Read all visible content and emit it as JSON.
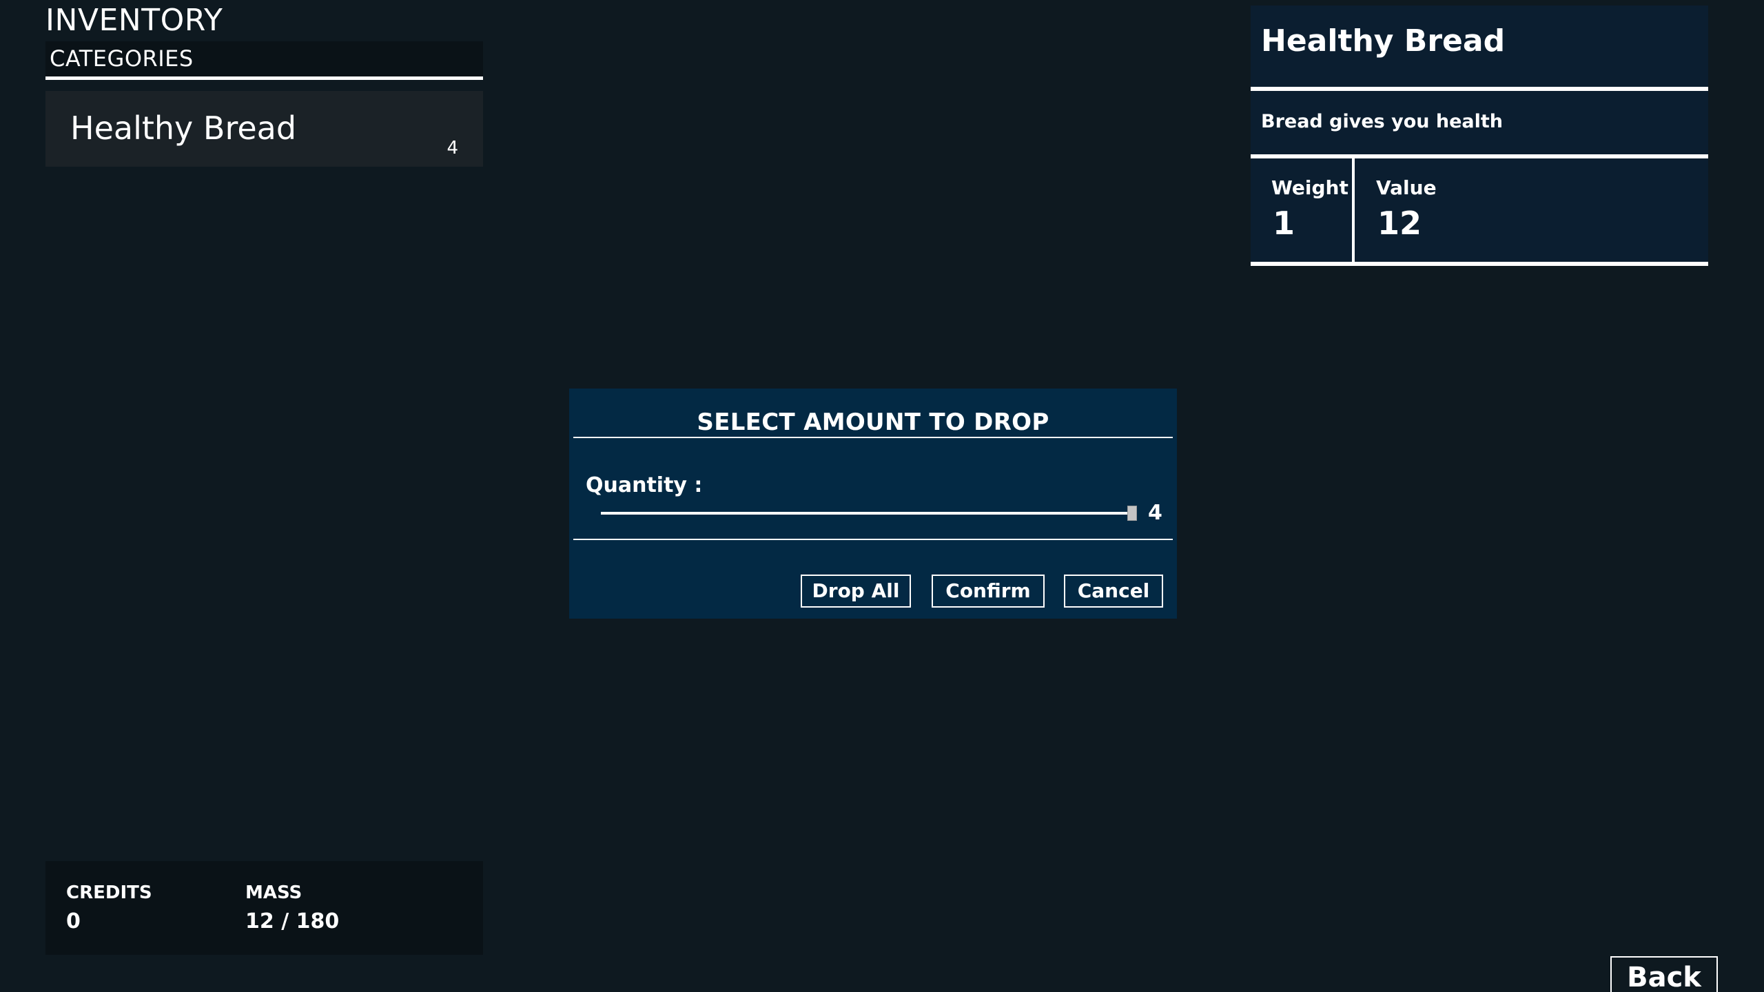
{
  "inventory": {
    "title": "INVENTORY",
    "categories_label": "CATEGORIES",
    "items": [
      {
        "name": "Healthy Bread",
        "count": "4"
      }
    ]
  },
  "stats": {
    "credits_label": "CREDITS",
    "credits_value": "0",
    "mass_label": "MASS",
    "mass_value": "12 / 180"
  },
  "detail": {
    "title": "Healthy Bread",
    "description": "Bread gives you health",
    "weight_label": "Weight",
    "weight_value": "1",
    "value_label": "Value",
    "value_value": "12"
  },
  "drop_dialog": {
    "title": "SELECT AMOUNT TO DROP",
    "quantity_label": "Quantity :",
    "slider": {
      "min": 0,
      "max": 4,
      "value": 4,
      "display": "4"
    },
    "buttons": {
      "drop_all": "Drop All",
      "confirm": "Confirm",
      "cancel": "Cancel"
    }
  },
  "back_label": "Back",
  "colors": {
    "background": "#0e1920",
    "panel_dark": "#0a1217",
    "item_row": "#1b2227",
    "detail_panel": "#0b1e30",
    "modal": "#032944",
    "text": "#ffffff"
  }
}
